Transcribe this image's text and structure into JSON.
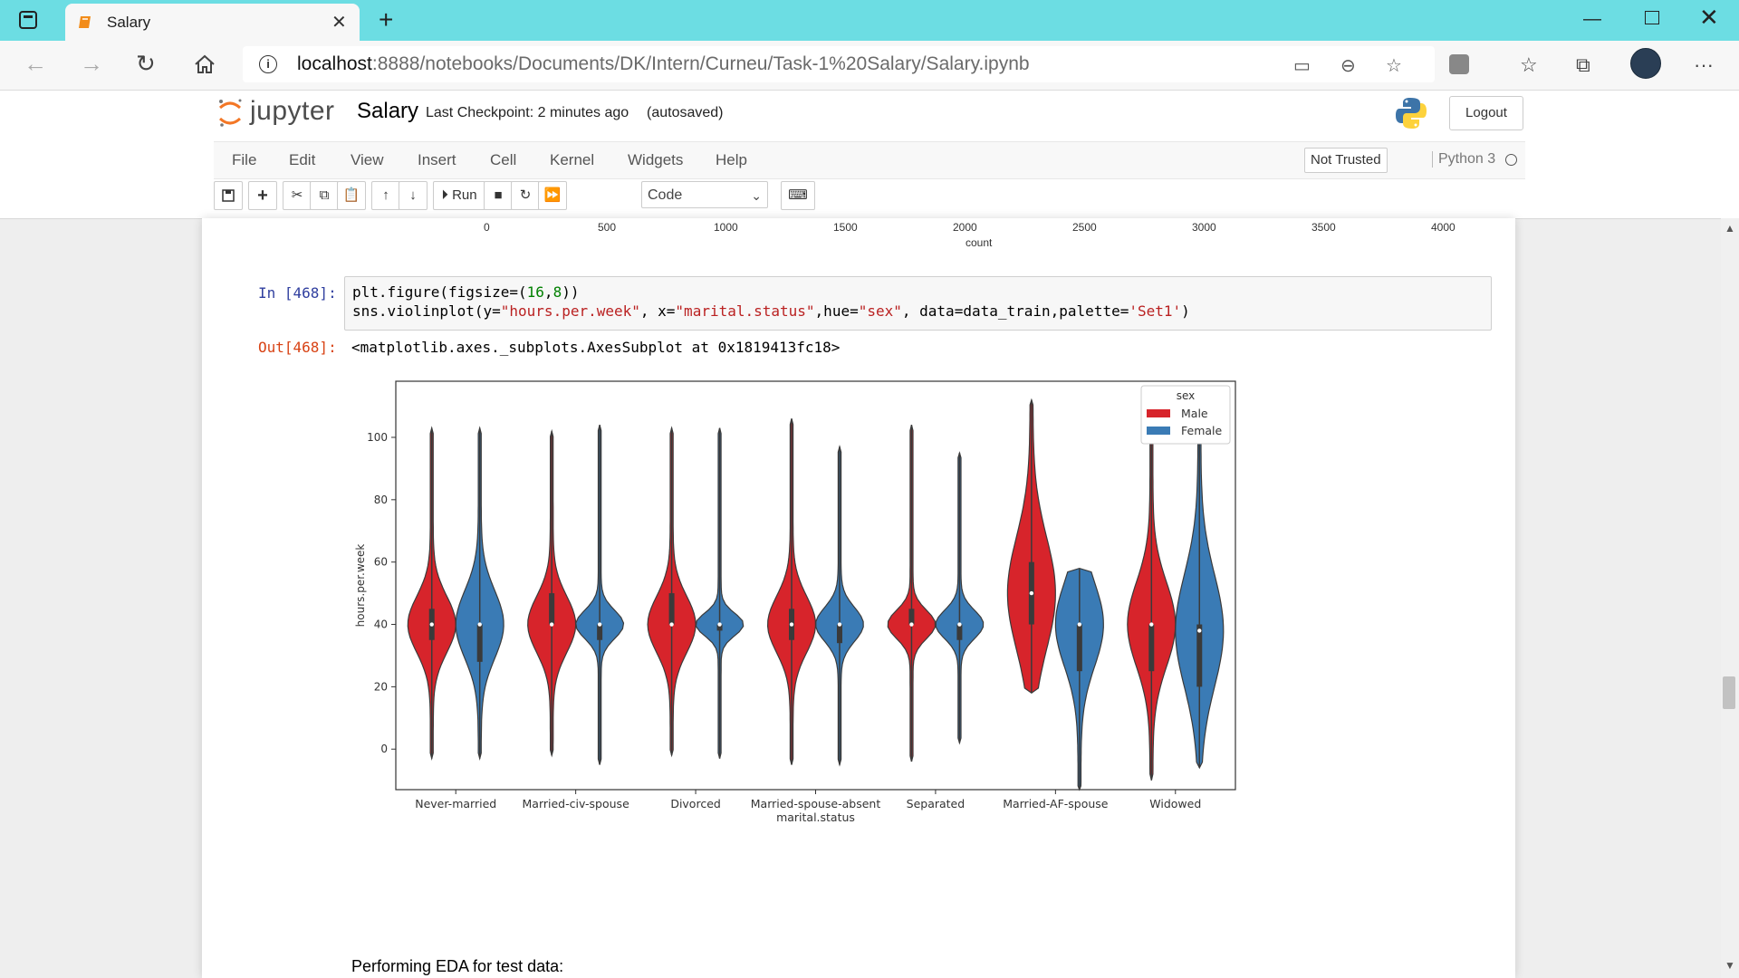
{
  "browser": {
    "tab_title": "Salary",
    "url_host": "localhost",
    "url_path": ":8888/notebooks/Documents/DK/Intern/Curneu/Task-1%20Salary/Salary.ipynb",
    "new_tab_glyph": "+"
  },
  "jupyter": {
    "logo_text": "jupyter",
    "notebook_name": "Salary",
    "checkpoint": "Last Checkpoint: 2 minutes ago",
    "autosave": "(autosaved)",
    "logout_label": "Logout",
    "menu": [
      "File",
      "Edit",
      "View",
      "Insert",
      "Cell",
      "Kernel",
      "Widgets",
      "Help"
    ],
    "trust_label": "Not Trusted",
    "kernel_label": "Python 3",
    "run_label": "Run",
    "cell_type": "Code"
  },
  "previous_output": {
    "x_ticks": [
      "0",
      "500",
      "1000",
      "1500",
      "2000",
      "2500",
      "3000",
      "3500",
      "4000"
    ],
    "x_label": "count"
  },
  "cell": {
    "in_prompt": "In [468]:",
    "out_prompt": "Out[468]:",
    "output_text": "<matplotlib.axes._subplots.AxesSubplot at 0x1819413fc18>"
  },
  "markdown": {
    "text": "Performing EDA for test data:"
  },
  "chart_data": {
    "type": "violin",
    "categories": [
      "Never-married",
      "Married-civ-spouse",
      "Divorced",
      "Married-spouse-absent",
      "Separated",
      "Married-AF-spouse",
      "Widowed"
    ],
    "xlabel": "marital.status",
    "ylabel": "hours.per.week",
    "yticks": [
      0,
      20,
      40,
      60,
      80,
      100
    ],
    "ylim": [
      -13,
      118
    ],
    "legend": {
      "title": "sex",
      "position": "top-right"
    },
    "series": [
      {
        "name": "Male",
        "color": "#d7242b",
        "violins": [
          {
            "min": -3,
            "max": 103,
            "q1": 35,
            "median": 40,
            "q3": 45
          },
          {
            "min": -2,
            "max": 102,
            "q1": 40,
            "median": 40,
            "q3": 50
          },
          {
            "min": -2,
            "max": 103,
            "q1": 40,
            "median": 40,
            "q3": 50
          },
          {
            "min": -5,
            "max": 106,
            "q1": 35,
            "median": 40,
            "q3": 45
          },
          {
            "min": -4,
            "max": 104,
            "q1": 40,
            "median": 40,
            "q3": 45
          },
          {
            "min": 18,
            "max": 112,
            "q1": 40,
            "median": 50,
            "q3": 60
          },
          {
            "min": -10,
            "max": 110,
            "q1": 25,
            "median": 40,
            "q3": 40
          }
        ]
      },
      {
        "name": "Female",
        "color": "#3a7bb5",
        "violins": [
          {
            "min": -3,
            "max": 103,
            "q1": 28,
            "median": 40,
            "q3": 40
          },
          {
            "min": -5,
            "max": 104,
            "q1": 35,
            "median": 40,
            "q3": 40
          },
          {
            "min": -3,
            "max": 103,
            "q1": 38,
            "median": 40,
            "q3": 40
          },
          {
            "min": -5,
            "max": 97,
            "q1": 34,
            "median": 40,
            "q3": 40
          },
          {
            "min": 2,
            "max": 95,
            "q1": 35,
            "median": 40,
            "q3": 40
          },
          {
            "min": -13,
            "max": 58,
            "q1": 25,
            "median": 40,
            "q3": 40
          },
          {
            "min": -6,
            "max": 103,
            "q1": 20,
            "median": 38,
            "q3": 40
          }
        ]
      }
    ]
  }
}
